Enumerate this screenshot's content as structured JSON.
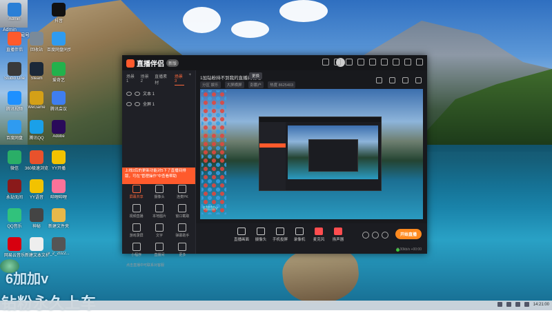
{
  "overlay": {
    "streamer_name": "Admin",
    "streamer_badge": "腾闻号",
    "streamer_sub": "294",
    "big_line1": "6加加v",
    "big_line2": "钻粉永久上车"
  },
  "desktop_icons": [
    {
      "label": "Admin",
      "icon": "user-folder-icon",
      "color": "#2a7fd6"
    },
    {
      "label": "抖音",
      "icon": "tiktok-icon",
      "color": "#111111"
    },
    {
      "label": "直播伴侣",
      "icon": "live-companion-icon",
      "color": "#ff5a2c"
    },
    {
      "label": "回收站",
      "icon": "recycle-bin-icon",
      "color": "#7a8a99"
    },
    {
      "label": "百度网盘同步空间",
      "icon": "baidu-netdisk-icon",
      "color": "#2f9bf0"
    },
    {
      "label": "Studio One",
      "icon": "studio-one-icon",
      "color": "#3a3a3a"
    },
    {
      "label": "Steam",
      "icon": "steam-icon",
      "color": "#1b2838"
    },
    {
      "label": "爱奇艺",
      "icon": "iqiyi-icon",
      "color": "#22b14c"
    },
    {
      "label": "腾讯视频",
      "icon": "tencent-video-icon",
      "color": "#1e90ff"
    },
    {
      "label": "WeGame",
      "icon": "wegame-icon",
      "color": "#d4a017"
    },
    {
      "label": "腾讯会议",
      "icon": "tencent-meeting-icon",
      "color": "#3f7ef0"
    },
    {
      "label": "百度网盘",
      "icon": "baidu-pan-icon",
      "color": "#2f9bf0"
    },
    {
      "label": "腾讯QQ",
      "icon": "qq-icon",
      "color": "#1aa0e8"
    },
    {
      "label": "Adobe",
      "icon": "adobe-premiere-icon",
      "color": "#2a0a5a"
    },
    {
      "label": "微信",
      "icon": "wechat-icon",
      "color": "#2aae67"
    },
    {
      "label": "360极速浏览器",
      "icon": "browser-360-icon",
      "color": "#e8522c"
    },
    {
      "label": "YY开播",
      "icon": "yy-live-icon",
      "color": "#f2c200"
    },
    {
      "label": "永劫无间",
      "icon": "naraka-icon",
      "color": "#8a1a1a"
    },
    {
      "label": "YY语音",
      "icon": "yy-voice-icon",
      "color": "#f2c200"
    },
    {
      "label": "哔哩哔哩",
      "icon": "bilibili-icon",
      "color": "#fb7299"
    },
    {
      "label": "QQ音乐",
      "icon": "qq-music-icon",
      "color": "#31c27c"
    },
    {
      "label": "神秘",
      "icon": "mystery-app-icon",
      "color": "#444444"
    },
    {
      "label": "新建文件夹",
      "icon": "folder-icon",
      "color": "#e8b84a"
    },
    {
      "label": "网易云音乐",
      "icon": "netease-music-icon",
      "color": "#d7000f"
    },
    {
      "label": "新建文本文档",
      "icon": "text-doc-icon",
      "color": "#eeeeee"
    },
    {
      "label": "v_2_2022...",
      "icon": "video-file-icon",
      "color": "#555555"
    }
  ],
  "window": {
    "app_name": "直播伴侣",
    "version": "新版",
    "left_tabs": [
      "场景1",
      "场景2",
      "直播素材",
      "场景3"
    ],
    "active_tab_index": 3,
    "layers": [
      {
        "label": "文本 1"
      },
      {
        "label": "全屏 1"
      }
    ],
    "notice": "上线2后的更新功能对5下了直播间排版，可在“管理操作”中查看帮助",
    "tools": [
      {
        "label": "屏幕共享",
        "icon": "screen-share-icon",
        "active": true
      },
      {
        "label": "摄像头",
        "icon": "camera-icon",
        "active": false
      },
      {
        "label": "连麦PK",
        "icon": "pk-icon",
        "active": false
      },
      {
        "label": "视频直播",
        "icon": "video-icon",
        "active": false
      },
      {
        "label": "本地图片",
        "icon": "image-icon",
        "active": false
      },
      {
        "label": "窗口截取",
        "icon": "window-capture-icon",
        "active": false
      },
      {
        "label": "游戏录屏",
        "icon": "game-capture-icon",
        "active": false
      },
      {
        "label": "文字",
        "icon": "text-icon",
        "active": false
      },
      {
        "label": "弹幕助手",
        "icon": "danmaku-icon",
        "active": false
      },
      {
        "label": "小程序",
        "icon": "mini-app-icon",
        "active": false
      },
      {
        "label": "直播间",
        "icon": "live-room-icon",
        "active": false
      },
      {
        "label": "更多",
        "icon": "more-icon",
        "active": false
      }
    ],
    "bottom_hint": "点击直播中可联系对客服",
    "stream_title": "1加钻粉持不到我的直播间攻略",
    "stream_tag": "更换",
    "stream_meta": [
      "分区 娱乐",
      "大屏横屏",
      "彭鹏户",
      "热度 8625403"
    ],
    "controls": [
      {
        "label": "直播画面",
        "icon": "display-icon"
      },
      {
        "label": "摄像头",
        "icon": "webcam-icon"
      },
      {
        "label": "手机投屏",
        "icon": "phone-cast-icon"
      },
      {
        "label": "录像机",
        "icon": "recorder-icon"
      },
      {
        "label": "麦克风",
        "icon": "mic-icon",
        "red": true
      },
      {
        "label": "扬声器",
        "icon": "speaker-icon",
        "red": true
      }
    ],
    "go_live": "开始直播",
    "status_right": "9.30kb/s  +00:00",
    "preview_watermark": "6加加v"
  },
  "taskbar": {
    "clock": "14:21:00",
    "accent": "#cfd6dd"
  }
}
